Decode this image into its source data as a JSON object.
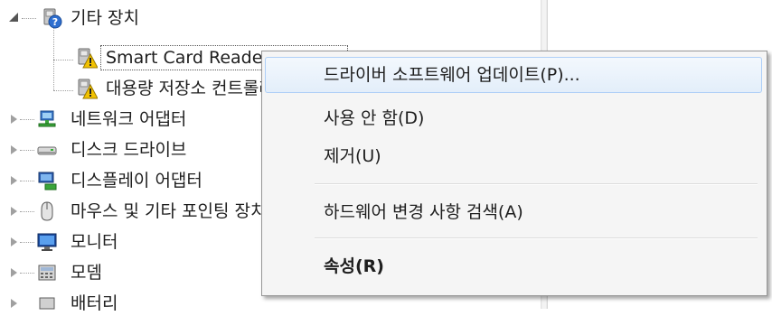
{
  "tree": {
    "items": [
      {
        "label": "기타 장치",
        "expanded": true,
        "icon": "unknown-device-icon"
      },
      {
        "label": "Smart Card Reader USB",
        "icon": "warning-device-icon",
        "selected": true
      },
      {
        "label": "대용량 저장소 컨트롤러",
        "icon": "warning-device-icon"
      },
      {
        "label": "네트워크 어댑터",
        "icon": "network-adapter-icon"
      },
      {
        "label": "디스크 드라이브",
        "icon": "disk-drive-icon"
      },
      {
        "label": "디스플레이 어댑터",
        "icon": "display-adapter-icon"
      },
      {
        "label": "마우스 및 기타 포인팅 장치",
        "icon": "mouse-icon"
      },
      {
        "label": "모니터",
        "icon": "monitor-icon"
      },
      {
        "label": "모뎀",
        "icon": "modem-icon"
      },
      {
        "label": "배터리",
        "icon": "battery-icon"
      }
    ]
  },
  "context_menu": {
    "items": [
      {
        "label": "드라이버 소프트웨어 업데이트(P)..."
      },
      {
        "label": "사용 안 함(D)"
      },
      {
        "label": "제거(U)"
      },
      {
        "label": "하드웨어 변경 사항 검색(A)"
      },
      {
        "label": "속성(R)",
        "bold": true
      }
    ]
  },
  "colors": {
    "menu_highlight_border": "#aecff7",
    "menu_background": "#f5f5f5",
    "warning_yellow": "#f2c200"
  }
}
